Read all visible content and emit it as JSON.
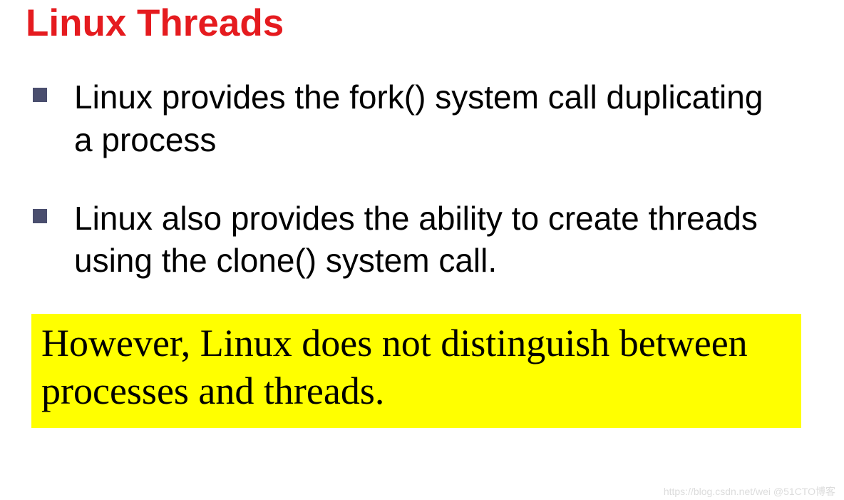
{
  "title": "Linux Threads",
  "bullets": [
    {
      "text": "Linux provides the fork() system call duplicating a process"
    },
    {
      "text": "Linux also provides the ability to create threads using the clone() system call."
    }
  ],
  "highlight": {
    "text": "However, Linux does not distinguish between processes and threads."
  },
  "watermark": "https://blog.csdn.net/wei @51CTO博客"
}
